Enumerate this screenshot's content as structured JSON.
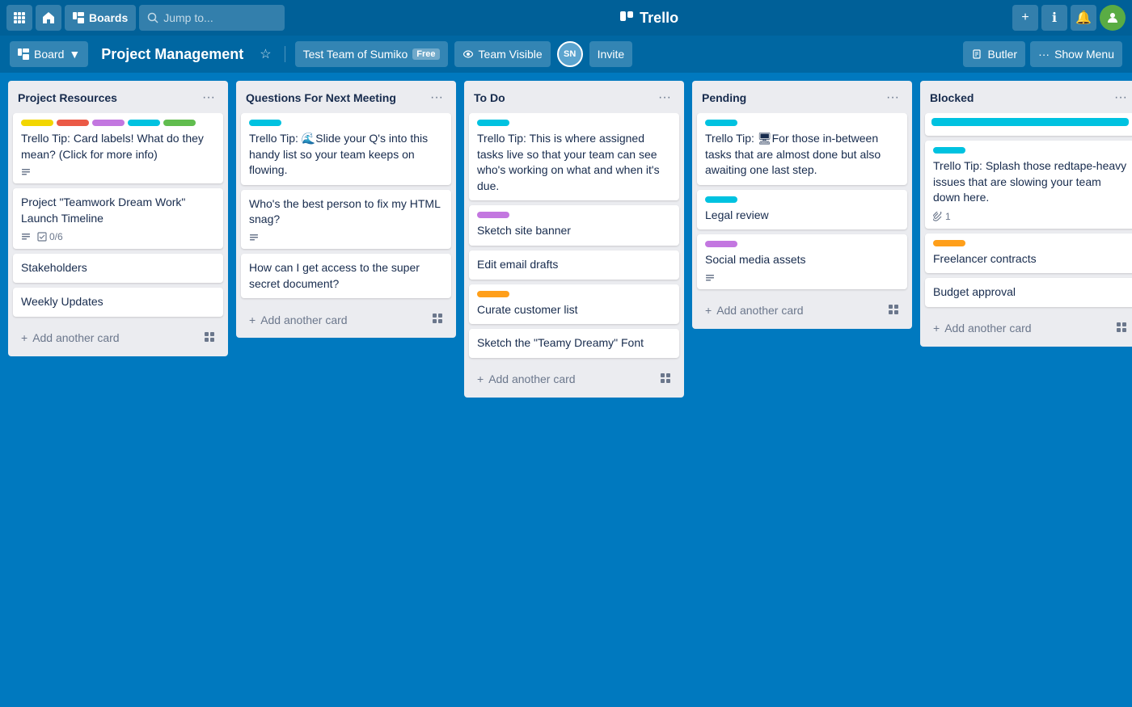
{
  "nav": {
    "boards_label": "Boards",
    "search_placeholder": "Jump to...",
    "trello_label": "Trello",
    "add_tooltip": "+",
    "info_tooltip": "ℹ",
    "notif_tooltip": "🔔",
    "profile_tooltip": "👤"
  },
  "board_header": {
    "board_label": "Board",
    "title": "Project Management",
    "team_label": "Test Team of Sumiko",
    "free_badge": "Free",
    "team_visible_label": "Team Visible",
    "avatar_initials": "SN",
    "invite_label": "Invite",
    "butler_label": "Butler",
    "show_menu_label": "Show Menu"
  },
  "lists": [
    {
      "id": "project-resources",
      "title": "Project Resources",
      "cards": [
        {
          "id": "tip-labels",
          "labels": [
            "yellow",
            "red",
            "purple",
            "teal",
            "green"
          ],
          "text": "Trello Tip: Card labels! What do they mean? (Click for more info)",
          "badges": [
            "description"
          ]
        },
        {
          "id": "launch-timeline",
          "labels": [],
          "text": "Project \"Teamwork Dream Work\" Launch Timeline",
          "badges": [
            "description",
            "checklist"
          ],
          "checklist": "0/6"
        },
        {
          "id": "stakeholders",
          "labels": [],
          "text": "Stakeholders",
          "badges": []
        },
        {
          "id": "weekly-updates",
          "labels": [],
          "text": "Weekly Updates",
          "badges": []
        }
      ],
      "add_card_label": "Add another card"
    },
    {
      "id": "questions-next-meeting",
      "title": "Questions For Next Meeting",
      "cards": [
        {
          "id": "tip-questions",
          "labels": [
            "cyan"
          ],
          "text": "Trello Tip: 🌊Slide your Q's into this handy list so your team keeps on flowing.",
          "badges": []
        },
        {
          "id": "html-snag",
          "labels": [],
          "text": "Who's the best person to fix my HTML snag?",
          "badges": [
            "description"
          ]
        },
        {
          "id": "secret-document",
          "labels": [],
          "text": "How can I get access to the super secret document?",
          "badges": []
        }
      ],
      "add_card_label": "Add another card"
    },
    {
      "id": "to-do",
      "title": "To Do",
      "cards": [
        {
          "id": "tip-todo",
          "labels": [
            "cyan"
          ],
          "text": "Trello Tip: This is where assigned tasks live so that your team can see who's working on what and when it's due.",
          "badges": []
        },
        {
          "id": "sketch-banner",
          "labels": [
            "purple"
          ],
          "text": "Sketch site banner",
          "badges": []
        },
        {
          "id": "edit-email",
          "labels": [],
          "text": "Edit email drafts",
          "badges": []
        },
        {
          "id": "curate-customer",
          "labels": [
            "orange"
          ],
          "text": "Curate customer list",
          "badges": []
        },
        {
          "id": "sketch-font",
          "labels": [],
          "text": "Sketch the \"Teamy Dreamy\" Font",
          "badges": []
        }
      ],
      "add_card_label": "Add another card"
    },
    {
      "id": "pending",
      "title": "Pending",
      "cards": [
        {
          "id": "tip-pending",
          "labels": [
            "cyan"
          ],
          "text": "Trello Tip: 🖥For those in-between tasks that are almost done but also awaiting one last step.",
          "badges": []
        },
        {
          "id": "legal-review",
          "labels": [
            "teal"
          ],
          "text": "Legal review",
          "badges": []
        },
        {
          "id": "social-media",
          "labels": [
            "purple"
          ],
          "text": "Social media assets",
          "badges": [
            "description"
          ]
        }
      ],
      "add_card_label": "Add another card"
    },
    {
      "id": "blocked",
      "title": "Blocked",
      "cards": [
        {
          "id": "blocked-label-card",
          "labels": [
            "teal-wide"
          ],
          "text": "",
          "badges": []
        },
        {
          "id": "tip-blocked",
          "labels": [
            "cyan"
          ],
          "text": "Trello Tip: Splash those redtape-heavy issues that are slowing your team down here.",
          "badges": [
            "attachment"
          ],
          "attachment_count": "1"
        },
        {
          "id": "freelancer-contracts",
          "labels": [
            "orange"
          ],
          "text": "Freelancer contracts",
          "badges": []
        },
        {
          "id": "budget-approval",
          "labels": [],
          "text": "Budget approval",
          "badges": []
        }
      ],
      "add_card_label": "Add another card"
    }
  ]
}
